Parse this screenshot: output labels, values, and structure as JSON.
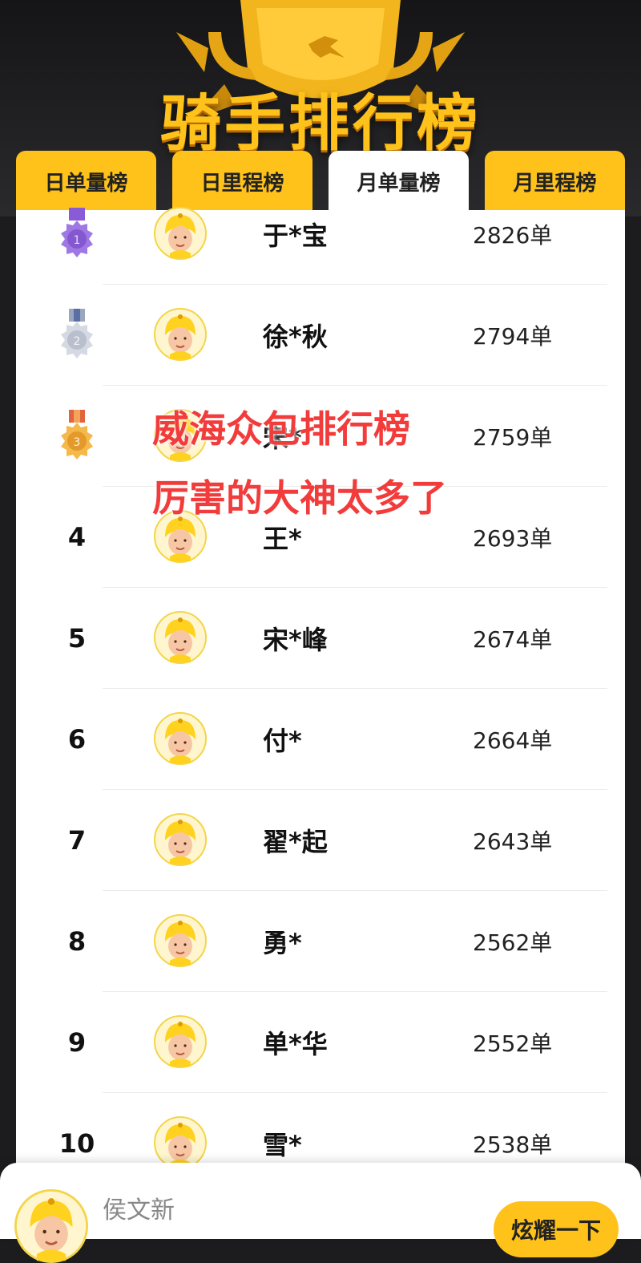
{
  "header": {
    "title": "骑手排行榜"
  },
  "tabs": [
    {
      "label": "日单量榜",
      "active": false
    },
    {
      "label": "日里程榜",
      "active": false
    },
    {
      "label": "月单量榜",
      "active": true
    },
    {
      "label": "月里程榜",
      "active": false
    }
  ],
  "ranking": [
    {
      "rank": "1",
      "medal": "gold-medal-icon",
      "name": "于*宝",
      "orders": "2826单"
    },
    {
      "rank": "2",
      "medal": "silver-medal-icon",
      "name": "徐*秋",
      "orders": "2794单"
    },
    {
      "rank": "3",
      "medal": "bronze-medal-icon",
      "name": "宋*",
      "orders": "2759单"
    },
    {
      "rank": "4",
      "name": "王*",
      "orders": "2693单"
    },
    {
      "rank": "5",
      "name": "宋*峰",
      "orders": "2674单"
    },
    {
      "rank": "6",
      "name": "付*",
      "orders": "2664单"
    },
    {
      "rank": "7",
      "name": "翟*起",
      "orders": "2643单"
    },
    {
      "rank": "8",
      "name": "勇*",
      "orders": "2562单"
    },
    {
      "rank": "9",
      "name": "单*华",
      "orders": "2552单"
    },
    {
      "rank": "10",
      "name": "雪*",
      "orders": "2538单"
    }
  ],
  "overlay": {
    "line1": "威海众包排行榜",
    "line2": "厉害的大神太多了"
  },
  "bottom_bar": {
    "name": "侯文新",
    "button_label": "炫耀一下"
  },
  "colors": {
    "accent": "#ffc21a",
    "overlay_text": "#f23b3b"
  }
}
